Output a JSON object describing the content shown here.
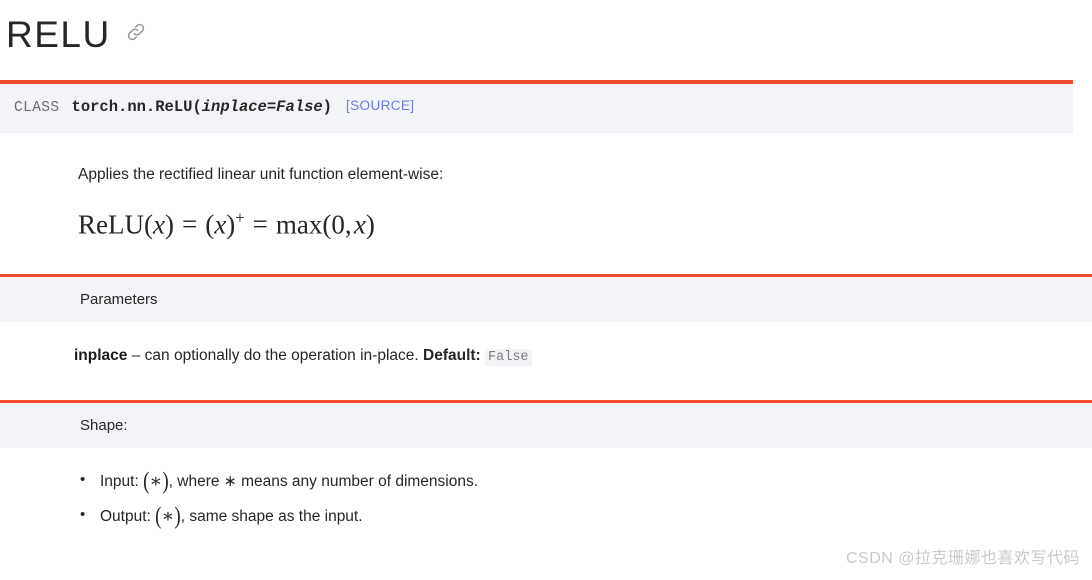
{
  "page": {
    "title": "RELU",
    "headerlink_icon": "link-chain-icon"
  },
  "signature": {
    "prename": "CLASS",
    "qualified_name": "torch.nn.ReLU",
    "open_paren": "(",
    "param": "inplace=False",
    "close_paren": ")",
    "source_link": "[SOURCE]",
    "accent_color": "#ee4c2c",
    "background_color": "#f3f4f7",
    "link_color": "#6c7ee1"
  },
  "description": "Applies the rectified linear unit function element-wise:",
  "formula": {
    "fn_name": "ReLU",
    "open": "(",
    "var": "x",
    "close": ")",
    "eq1": "=",
    "group_open": "(",
    "group_var": "x",
    "group_close": ")",
    "superscript": "+",
    "eq2": "=",
    "max_name": "max",
    "max_open": "(",
    "max_zero": "0,",
    "max_var": "x",
    "max_close": ")"
  },
  "parameters_section": {
    "heading": "Parameters",
    "items": [
      {
        "name": "inplace",
        "dash": "–",
        "description": "can optionally do the operation in-place.",
        "default_label": "Default:",
        "default_value": "False"
      }
    ]
  },
  "shape_section": {
    "heading": "Shape:",
    "items": [
      {
        "label": "Input:",
        "math_open": "(",
        "math_symbol": "∗",
        "math_close": ")",
        "text": ", where ∗ means any number of dimensions."
      },
      {
        "label": "Output:",
        "math_open": "(",
        "math_symbol": "∗",
        "math_close": ")",
        "text": ", same shape as the input."
      }
    ]
  },
  "watermark": {
    "text": "CSDN @拉克珊娜也喜欢写代码"
  }
}
